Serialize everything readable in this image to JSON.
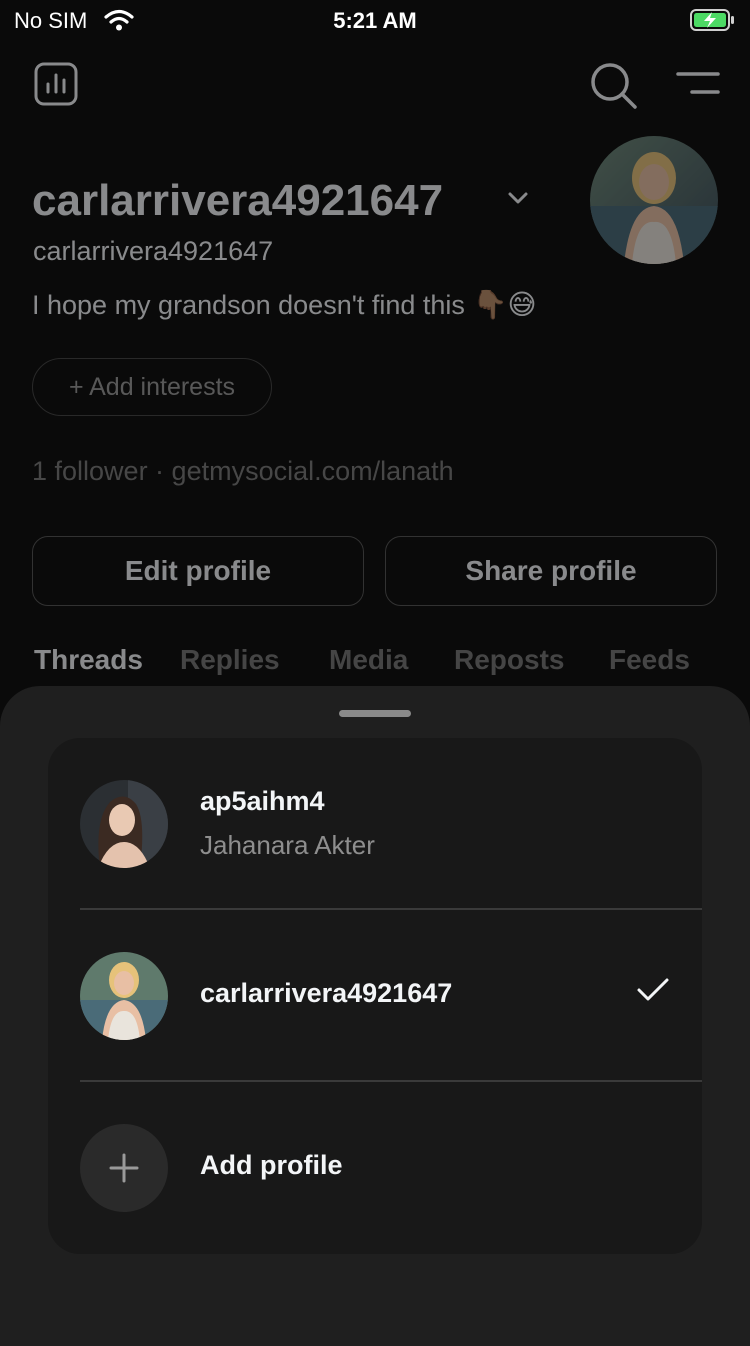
{
  "status_bar": {
    "carrier": "No SIM",
    "time": "5:21 AM"
  },
  "profile": {
    "username": "carlarrivera4921647",
    "handle": "carlarrivera4921647",
    "bio": "I hope my grandson doesn't find this",
    "bio_emojis": "👇🏽😅",
    "add_interests": "+ Add interests",
    "followers_line": "1 follower · getmysocial.com/lanath",
    "edit_button": "Edit profile",
    "share_button": "Share profile",
    "tabs": [
      "Threads",
      "Replies",
      "Media",
      "Reposts",
      "Feeds"
    ],
    "active_tab": "Threads"
  },
  "account_switcher": {
    "accounts": [
      {
        "username": "ap5aihm4",
        "name": "Jahanara Akter",
        "selected": false
      },
      {
        "username": "carlarrivera4921647",
        "name": "",
        "selected": true
      }
    ],
    "add_profile": "Add profile"
  },
  "colors": {
    "background": "#0a0a0a",
    "sheet": "#1f1f1f",
    "card": "#181818",
    "battery_green": "#4cd964"
  },
  "icons": [
    "wifi-icon",
    "battery-charging-icon",
    "insights-icon",
    "search-icon",
    "menu-icon",
    "chevron-down-icon",
    "checkmark-icon",
    "plus-icon"
  ]
}
